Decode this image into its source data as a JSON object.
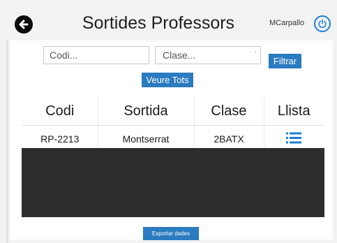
{
  "header": {
    "title": "Sortides Professors",
    "username": "MCarpallo",
    "back_icon": "arrow-left-circle-icon",
    "logout_icon": "power-icon"
  },
  "filters": {
    "codi_placeholder": "Codi...",
    "clase_placeholder": "Clase...",
    "filtrar_label": "Filtrar",
    "veure_tots_label": "Veure Tots"
  },
  "table": {
    "headers": [
      "Codi",
      "Sortida",
      "Clase",
      "Llista"
    ],
    "rows": [
      {
        "codi": "RP-2213",
        "sortida": "Montserrat",
        "clase": "2BATX",
        "llista_icon": "list-icon"
      }
    ]
  },
  "footer": {
    "export_label": "Exportar dades"
  },
  "colors": {
    "accent": "#2b7bc0",
    "icon_blue": "#1a7fd6",
    "dark_area": "#2d2d2d"
  }
}
